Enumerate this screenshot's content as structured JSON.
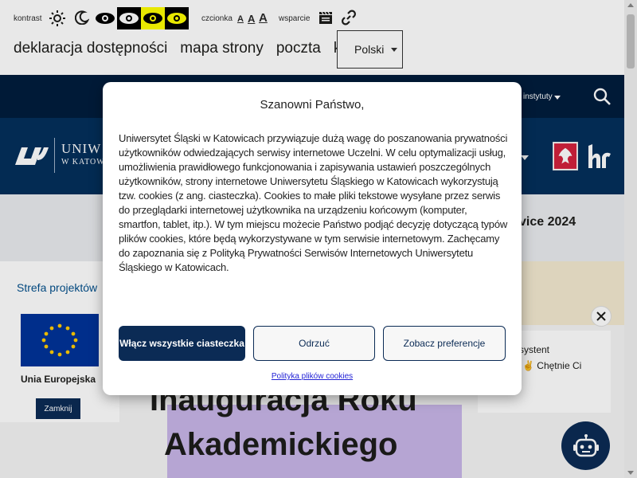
{
  "accessibility_bar": {
    "contrast_label": "kontrast",
    "font_label": "czcionka",
    "font_sizes": [
      "A",
      "A",
      "A"
    ],
    "support_label": "wsparcie"
  },
  "top_links": [
    "deklaracja dostępności",
    "mapa strony",
    "poczta",
    "kontakt"
  ],
  "language": {
    "selected": "Polski"
  },
  "nav": {
    "institutes_label": "instytuty",
    "logo_line1": "UNIW",
    "logo_line2": "W KATOW"
  },
  "band": {
    "text": "vice 2024"
  },
  "hero": {
    "title_line1": "Inauguracja Roku",
    "title_line2": "Akademickiego"
  },
  "project_zone": {
    "title": "Strefa projektów",
    "eu_label": "Unia Europejska",
    "close_label": "Zamknij"
  },
  "assistant": {
    "line1": "systent",
    "line2": "✌ Chętnie Ci"
  },
  "cookie_modal": {
    "title": "Szanowni Państwo,",
    "body": "Uniwersytet Śląski w Katowicach przywiązuje dużą wagę do poszanowania prywatności użytkowników odwiedzających serwisy internetowe Uczelni. W celu optymalizacji usług, umożliwienia prawidłowego funkcjonowania i zapisywania ustawień poszczególnych użytkowników, strony internetowe Uniwersytetu Śląskiego w Katowicach wykorzystują tzw. cookies (z ang. ciasteczka). Cookies to małe pliki tekstowe wysyłane przez serwis do przeglądarki internetowej użytkownika na urządzeniu końcowym (komputer, smartfon, tablet, itp.). W tym miejscu możecie Państwo podjąć decyzję dotyczącą typów plików cookies, które będą wykorzystywane w tym serwisie internetowym. Zachęcamy do zapoznania się z Polityką Prywatności Serwisów Internetowych Uniwersytetu Śląskiego w Katowicach.",
    "accept_label": "Włącz wszystkie ciasteczka",
    "deny_label": "Odrzuć",
    "prefs_label": "Zobacz preferencje",
    "policy_link": "Polityka plików cookies"
  },
  "colors": {
    "navy": "#04305c",
    "navy_dark": "#001d3d",
    "button_navy": "#0b2b55",
    "link_blue": "#2323d6"
  }
}
